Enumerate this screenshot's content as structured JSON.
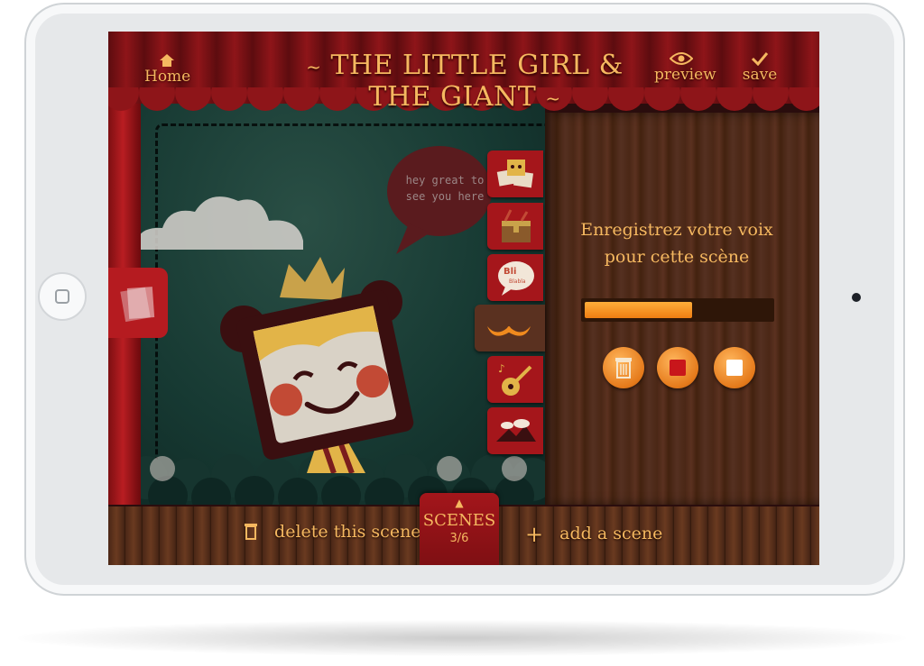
{
  "header": {
    "home_label": "Home",
    "title": "THE LITTLE GIRL & THE GIANT",
    "preview_label": "preview",
    "save_label": "save"
  },
  "stage": {
    "speech_bubble": "hey great to see you here"
  },
  "tools": [
    {
      "icon": "characters-icon"
    },
    {
      "icon": "props-chest-icon"
    },
    {
      "icon": "speech-bubble-icon",
      "text": "Bli Blabla"
    },
    {
      "icon": "mustache-icon"
    },
    {
      "icon": "music-guitar-icon"
    },
    {
      "icon": "landscape-icon"
    }
  ],
  "recorder": {
    "prompt_line1": "Enregistrez votre voix",
    "prompt_line2": "pour cette scène",
    "progress": 0.58,
    "buttons": [
      {
        "icon": "trash-icon"
      },
      {
        "icon": "record-icon"
      },
      {
        "icon": "stop-icon"
      }
    ]
  },
  "bottom": {
    "delete_label": "delete this scene",
    "scenes_label": "SCENES",
    "scenes_count": "3/6",
    "add_label": "add a scene"
  },
  "colors": {
    "accent": "#f5b860",
    "curtain_red": "#a5161b",
    "progress_orange": "#f08a1e"
  }
}
